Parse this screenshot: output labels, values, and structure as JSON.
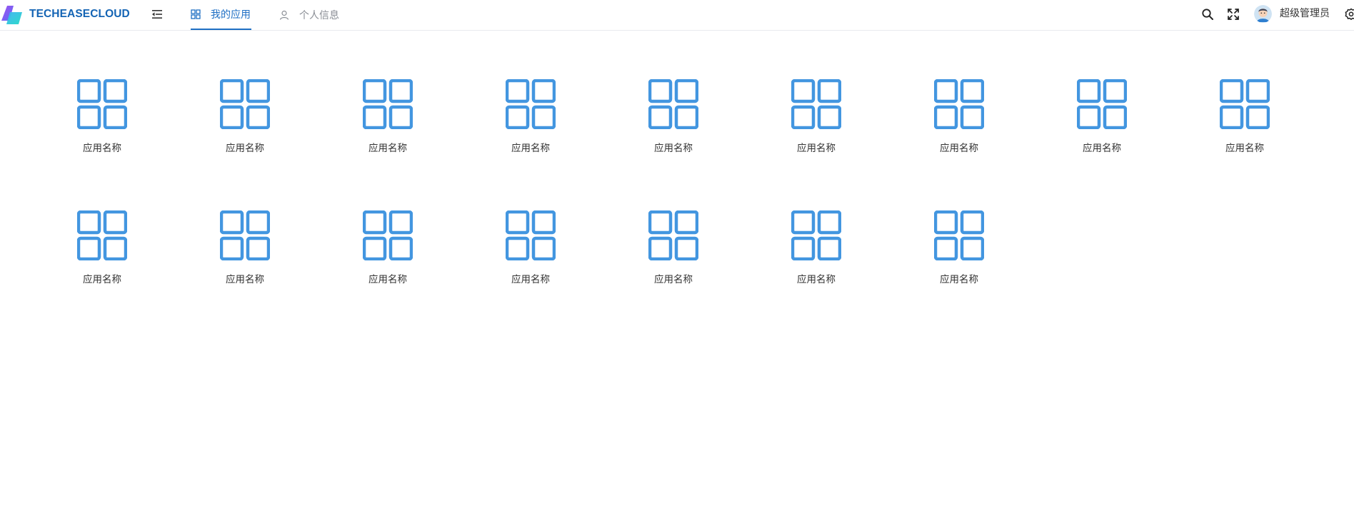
{
  "header": {
    "brand": "TECHEASECLOUD",
    "tabs": [
      {
        "label": "我的应用",
        "icon": "grid-icon",
        "active": true
      },
      {
        "label": "个人信息",
        "icon": "user-icon",
        "active": false
      }
    ],
    "tools": [
      "search-icon",
      "fullscreen-icon",
      "settings-icon"
    ],
    "username": "超级管理员",
    "accent_color": "#1f6fc4",
    "brand_color": "#1464b4"
  },
  "apps": [
    {
      "name": "应用名称"
    },
    {
      "name": "应用名称"
    },
    {
      "name": "应用名称"
    },
    {
      "name": "应用名称"
    },
    {
      "name": "应用名称"
    },
    {
      "name": "应用名称"
    },
    {
      "name": "应用名称"
    },
    {
      "name": "应用名称"
    },
    {
      "name": "应用名称"
    },
    {
      "name": "应用名称"
    },
    {
      "name": "应用名称"
    },
    {
      "name": "应用名称"
    },
    {
      "name": "应用名称"
    },
    {
      "name": "应用名称"
    },
    {
      "name": "应用名称"
    },
    {
      "name": "应用名称"
    }
  ],
  "app_icon_color": "#4396e0"
}
